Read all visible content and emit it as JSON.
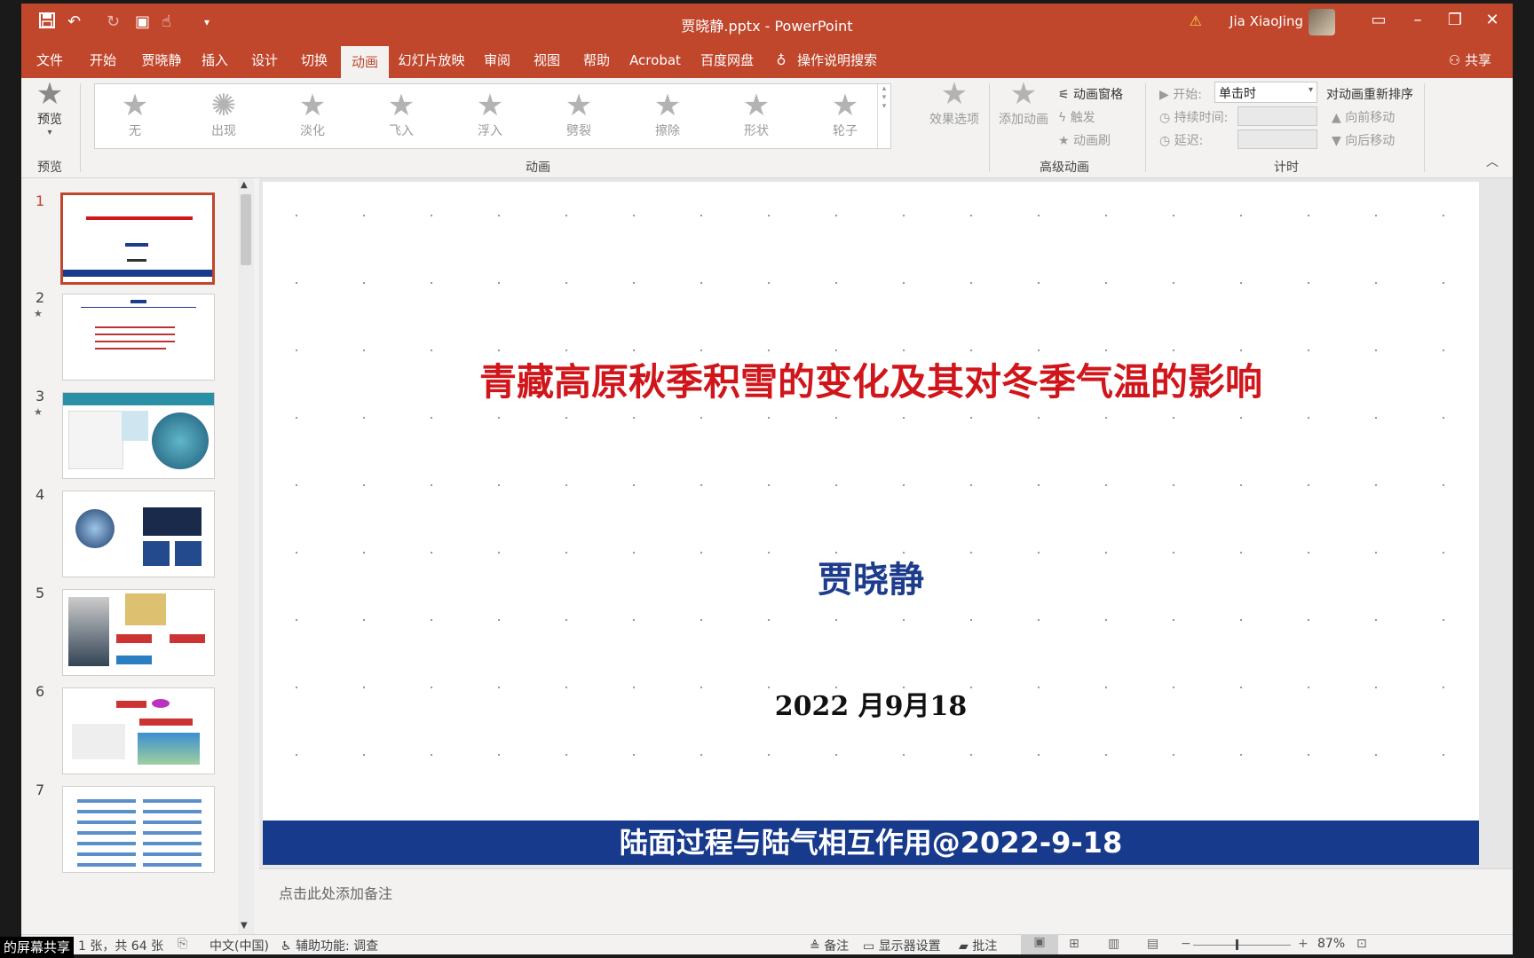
{
  "window": {
    "doc_title": "贾晓静.pptx  -  PowerPoint",
    "user_name": "Jia XiaoJing",
    "qa_icons": [
      "save-icon",
      "undo-icon",
      "redo-icon",
      "present-icon",
      "touch-icon",
      "customize-icon"
    ]
  },
  "tabs": [
    "文件",
    "开始",
    "贾晓静",
    "插入",
    "设计",
    "切换",
    "动画",
    "幻灯片放映",
    "审阅",
    "视图",
    "帮助",
    "Acrobat",
    "百度网盘"
  ],
  "active_tab": "动画",
  "tell_me": "操作说明搜索",
  "share": "共享",
  "ribbon": {
    "preview": {
      "button": "预览",
      "group": "预览"
    },
    "animations": {
      "items": [
        "无",
        "出现",
        "淡化",
        "飞入",
        "浮入",
        "劈裂",
        "擦除",
        "形状",
        "轮子"
      ],
      "effect_options": "效果选项",
      "group": "动画"
    },
    "advanced": {
      "add_animation": "添加动画",
      "pane": "动画窗格",
      "trigger": "触发",
      "painter": "动画刷",
      "group": "高级动画"
    },
    "timing": {
      "start_label": "开始:",
      "start_value": "单击时",
      "duration_label": "持续时间:",
      "delay_label": "延迟:",
      "reorder_title": "对动画重新排序",
      "move_earlier": "向前移动",
      "move_later": "向后移动",
      "group": "计时"
    }
  },
  "thumbnails": [
    {
      "num": "1",
      "selected": true,
      "star": false
    },
    {
      "num": "2",
      "selected": false,
      "star": true
    },
    {
      "num": "3",
      "selected": false,
      "star": true
    },
    {
      "num": "4",
      "selected": false,
      "star": false
    },
    {
      "num": "5",
      "selected": false,
      "star": false
    },
    {
      "num": "6",
      "selected": false,
      "star": false
    },
    {
      "num": "7",
      "selected": false,
      "star": false
    }
  ],
  "slide": {
    "title": "青藏高原秋季积雪的变化及其对冬季气温的影响",
    "author": "贾晓静",
    "date": "2022 月9月18",
    "footer": "陆面过程与陆气相互作用@2022-9-18"
  },
  "notes_placeholder": "点击此处添加备注",
  "status": {
    "slide_info": "1 张，共 64 张",
    "language": "中文(中国)",
    "accessibility": "辅助功能: 调查",
    "notes": "备注",
    "display_settings": "显示器设置",
    "comments": "批注",
    "zoom": "87%",
    "zoom_level": 0.87
  },
  "overlay": "的屏幕共享"
}
